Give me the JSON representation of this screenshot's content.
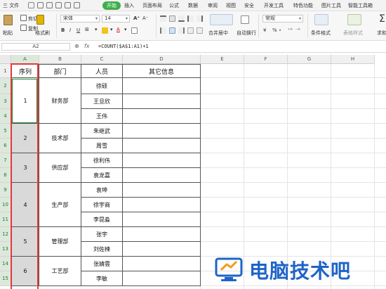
{
  "menu": {
    "items": [
      {
        "label": "三 文件",
        "x": 6
      },
      {
        "label": "开始",
        "active": true
      },
      {
        "label": "插入"
      },
      {
        "label": "页面布局"
      },
      {
        "label": "公式"
      },
      {
        "label": "数据"
      },
      {
        "label": "审阅"
      },
      {
        "label": "视图"
      },
      {
        "label": "安全"
      },
      {
        "label": "开发工具"
      },
      {
        "label": "特色功能"
      },
      {
        "label": "图片工具"
      },
      {
        "label": "智能工具箱"
      }
    ]
  },
  "ribbon": {
    "paste_label": "粘贴",
    "cut_label": "剪切",
    "copy_label": "复制",
    "format_painter_label": "格式刷",
    "font_name": "宋体",
    "font_size": "14",
    "merge_center_label": "合并居中",
    "wrap_label": "自动换行",
    "number_format": "常规",
    "cond_format_label": "条件格式",
    "table_style_label": "表格样式",
    "sum_label": "求和",
    "percent_label": "% ∘",
    "currency_label": "¥"
  },
  "formula_bar": {
    "cell_ref": "A2",
    "fx_label": "fx",
    "formula": "=COUNT($A$1:A1)+1"
  },
  "sheet": {
    "columns": [
      "A",
      "B",
      "C",
      "D",
      "E",
      "F",
      "G",
      "H"
    ],
    "rows": [
      "1",
      "2",
      "3",
      "4",
      "5",
      "6",
      "7",
      "8",
      "9",
      "10",
      "11",
      "12",
      "13",
      "14",
      "15"
    ],
    "headers": {
      "seq": "序列",
      "dept": "部门",
      "person": "人员",
      "other": "其它信息"
    },
    "groups": [
      {
        "seq": "1",
        "dept": "财务部",
        "people": [
          "徐硕",
          "王旦欣",
          "王伟"
        ]
      },
      {
        "seq": "2",
        "dept": "技术部",
        "people": [
          "朱继武",
          "周雪"
        ]
      },
      {
        "seq": "3",
        "dept": "供应部",
        "people": [
          "徐利伟",
          "袁龙嘉"
        ]
      },
      {
        "seq": "4",
        "dept": "生产部",
        "people": [
          "袁坤",
          "徐宇商",
          "李昆淼"
        ]
      },
      {
        "seq": "5",
        "dept": "管理部",
        "people": [
          "张宇",
          "刘佐楝"
        ]
      },
      {
        "seq": "6",
        "dept": "工艺部",
        "people": [
          "张婧雲",
          "李敏"
        ]
      }
    ]
  },
  "watermark": {
    "text": "电脑技术吧"
  }
}
